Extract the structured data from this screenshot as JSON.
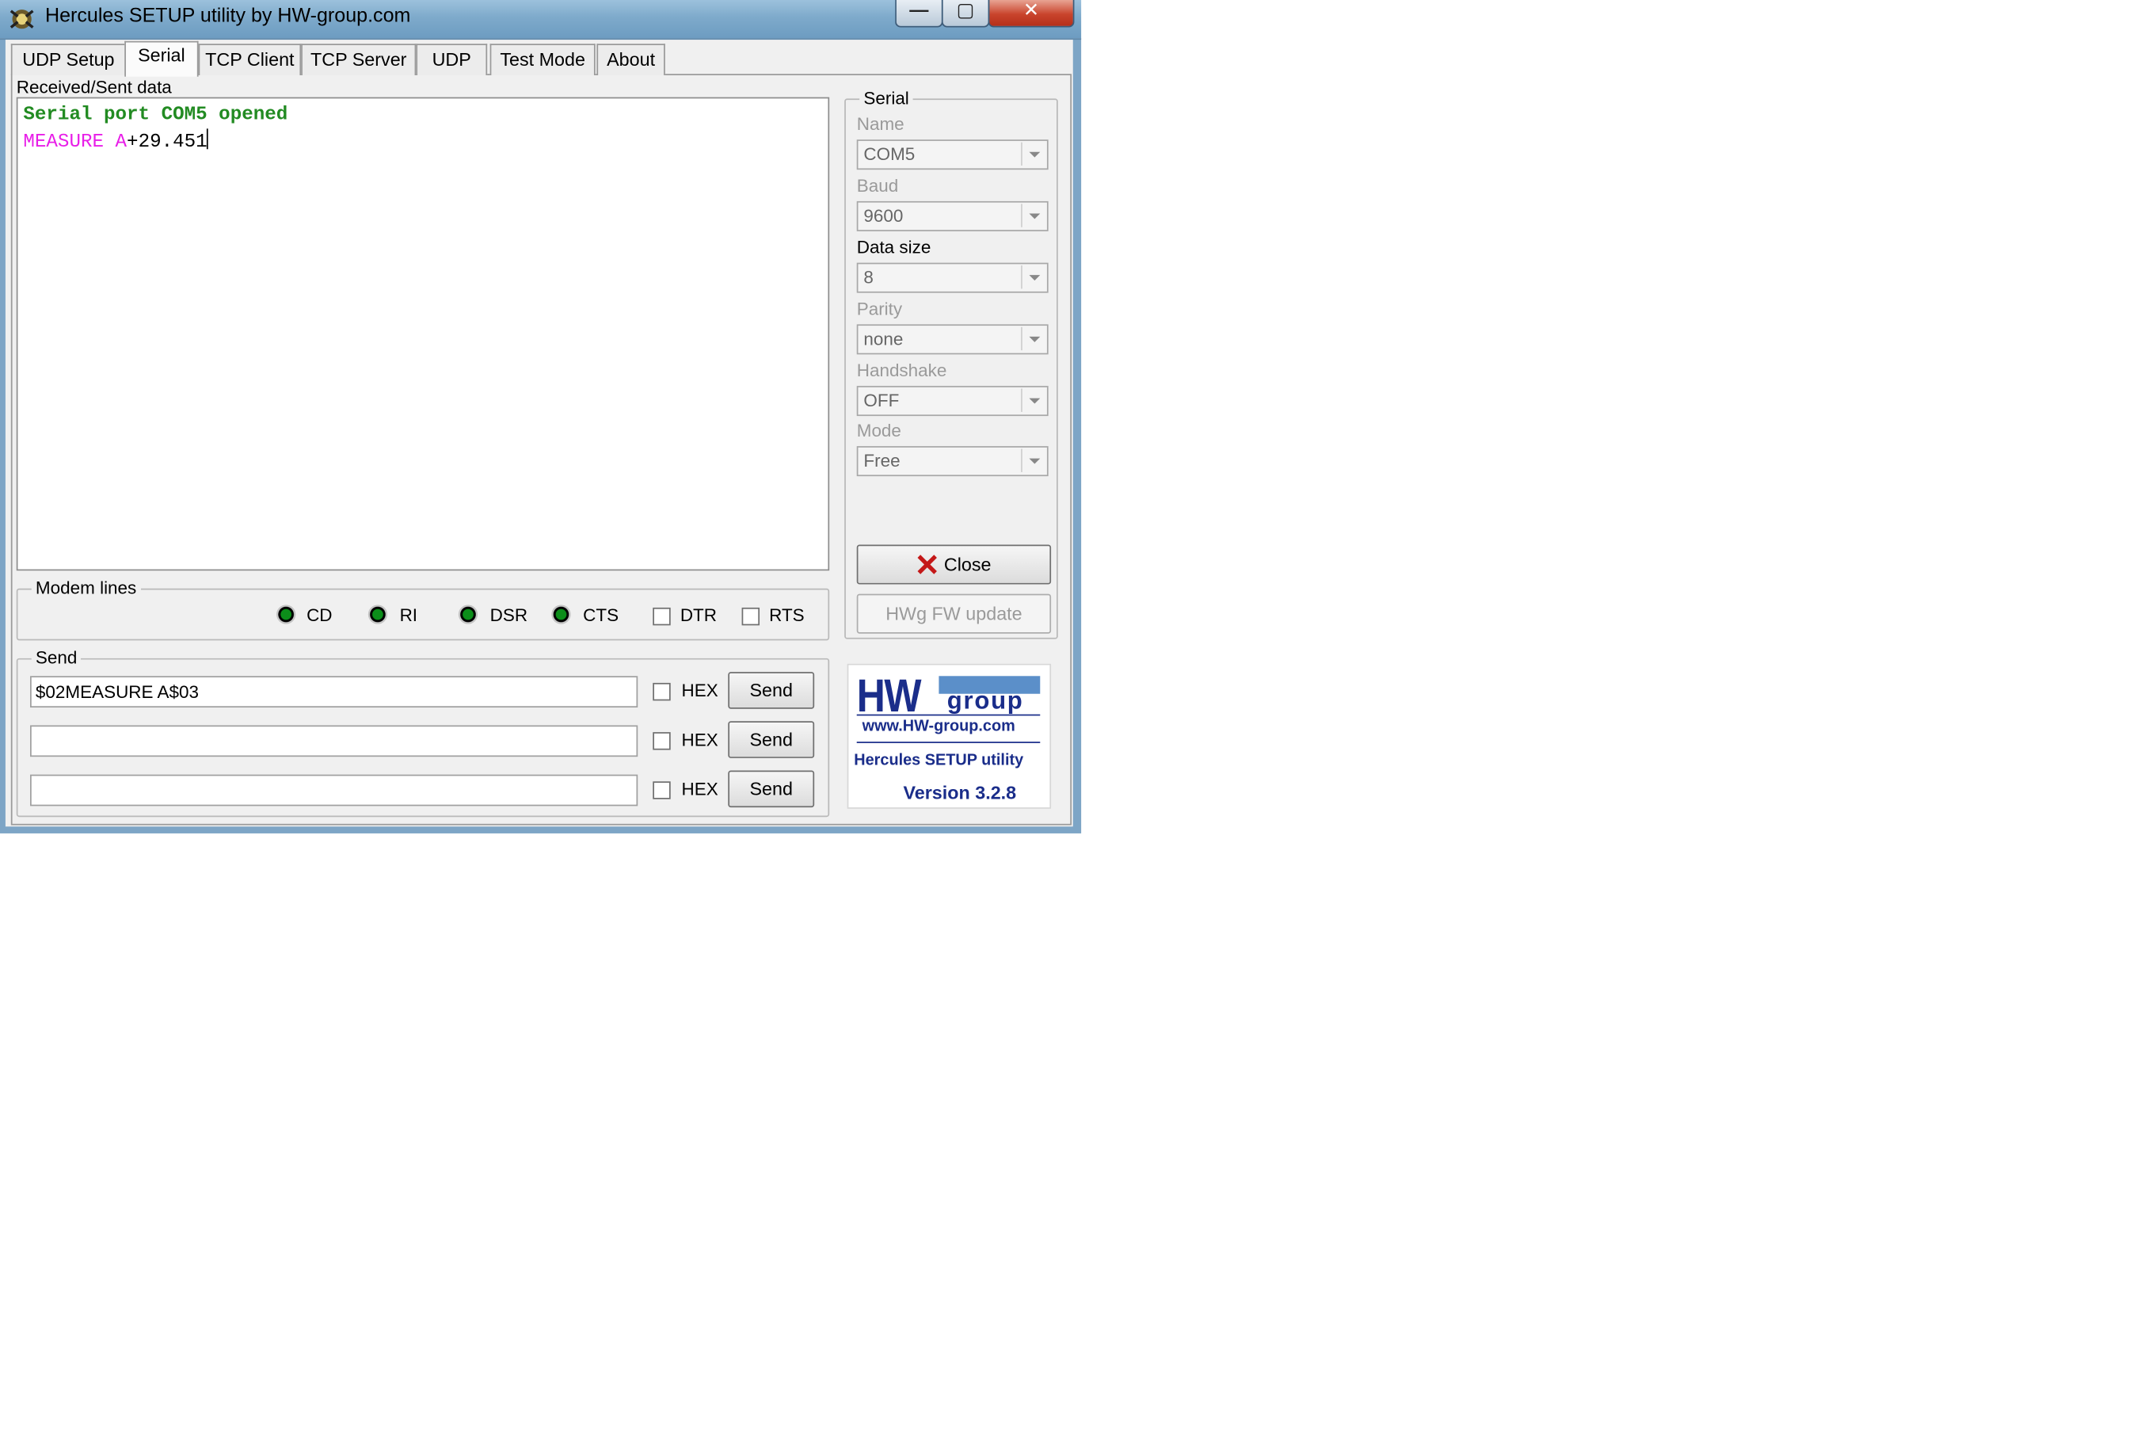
{
  "window": {
    "title": "Hercules SETUP utility by HW-group.com",
    "minimize_label": "—",
    "maximize_label": "▢",
    "close_label": "✕"
  },
  "tabs": [
    {
      "label": "UDP Setup"
    },
    {
      "label": "Serial",
      "active": true
    },
    {
      "label": "TCP Client"
    },
    {
      "label": "TCP Server"
    },
    {
      "label": "UDP"
    },
    {
      "label": "Test Mode"
    },
    {
      "label": "About"
    }
  ],
  "received": {
    "label": "Received/Sent data",
    "line1": "Serial port COM5 opened",
    "line2_prefix": "MEASURE A",
    "line2_value": "+29.451"
  },
  "modem_lines": {
    "title": "Modem lines",
    "cd": "CD",
    "ri": "RI",
    "dsr": "DSR",
    "cts": "CTS",
    "dtr": "DTR",
    "rts": "RTS"
  },
  "send": {
    "title": "Send",
    "rows": [
      {
        "value": "$02MEASURE A$03",
        "hex": "HEX",
        "button": "Send"
      },
      {
        "value": "",
        "hex": "HEX",
        "button": "Send"
      },
      {
        "value": "",
        "hex": "HEX",
        "button": "Send"
      }
    ]
  },
  "serial": {
    "title": "Serial",
    "name_label": "Name",
    "name_value": "COM5",
    "baud_label": "Baud",
    "baud_value": "9600",
    "datasize_label": "Data size",
    "datasize_value": "8",
    "parity_label": "Parity",
    "parity_value": "none",
    "handshake_label": "Handshake",
    "handshake_value": "OFF",
    "mode_label": "Mode",
    "mode_value": "Free",
    "close_button": "Close",
    "fw_button": "HWg FW update"
  },
  "logo": {
    "hw": "HW",
    "group": "group",
    "url": "www.HW-group.com",
    "product": "Hercules SETUP utility",
    "version": "Version  3.2.8"
  },
  "colors": {
    "opened_text": "#228b22",
    "sent_text": "#e81ee8",
    "brand": "#1a2d8a",
    "led_on": "#0c8e1a"
  }
}
